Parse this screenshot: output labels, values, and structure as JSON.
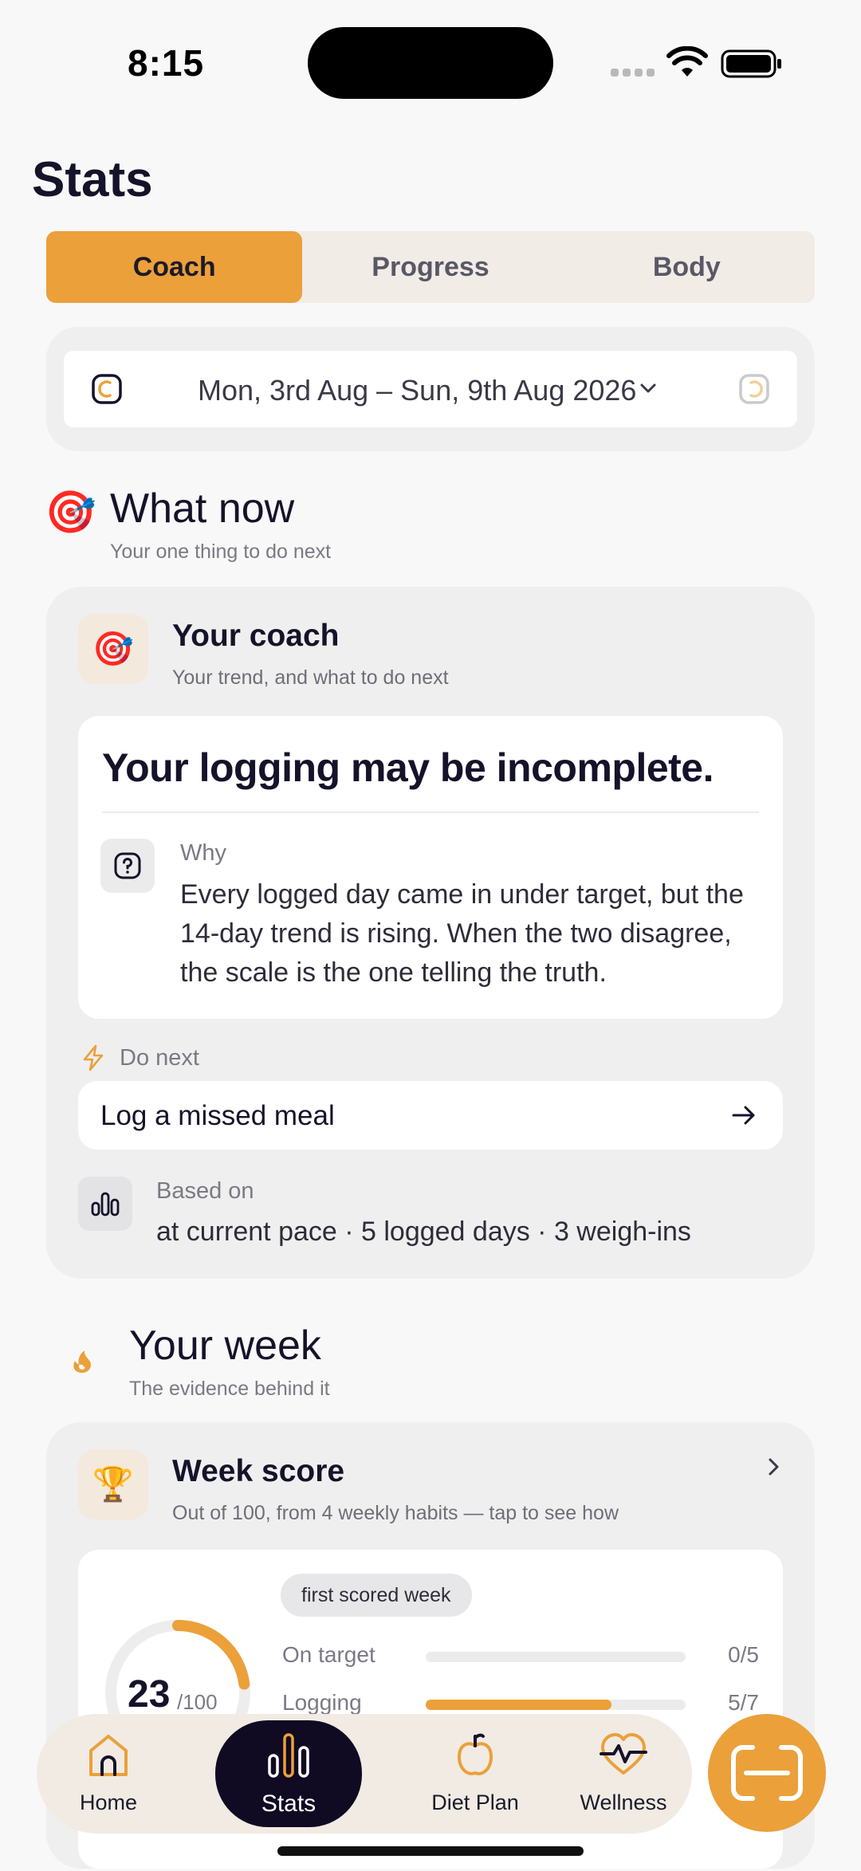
{
  "status_bar": {
    "time": "8:15"
  },
  "page": {
    "title": "Stats"
  },
  "tabs": [
    {
      "label": "Coach",
      "active": true
    },
    {
      "label": "Progress",
      "active": false
    },
    {
      "label": "Body",
      "active": false
    }
  ],
  "date_range": {
    "label": "Mon, 3rd Aug – Sun, 9th Aug 2026"
  },
  "what_now": {
    "emoji": "🎯",
    "title": "What now",
    "subtitle": "Your one thing to do next"
  },
  "coach_card": {
    "icon": "🎯",
    "title": "Your coach",
    "subtitle": "Your trend, and what to do next",
    "headline": "Your logging may be incomplete.",
    "why_label": "Why",
    "why_text": "Every logged day came in under target, but the 14-day trend is rising. When the two disagree, the scale is the one telling the truth.",
    "do_next_label": "Do next",
    "action_label": "Log a missed meal",
    "based_on_label": "Based on",
    "based_on_text": "at current pace · 5 logged days · 3 weigh-ins"
  },
  "your_week": {
    "title": "Your week",
    "subtitle": "The evidence behind it"
  },
  "week_score": {
    "icon": "🏆",
    "title": "Week score",
    "subtitle": "Out of 100, from 4 weekly habits — tap to see how",
    "pill": "first scored week",
    "score": "23",
    "score_max": "/100",
    "score_fraction": 0.23,
    "metrics": [
      {
        "label": "On target",
        "value": "0/5",
        "fraction": 0
      },
      {
        "label": "Logging",
        "value": "5/7",
        "fraction": 0.714
      }
    ]
  },
  "nav": [
    {
      "label": "Home",
      "icon": "home-icon",
      "active": false
    },
    {
      "label": "Stats",
      "icon": "stats-icon",
      "active": true
    },
    {
      "label": "Diet Plan",
      "icon": "apple-icon",
      "active": false
    },
    {
      "label": "Wellness",
      "icon": "heart-pulse-icon",
      "active": false
    }
  ],
  "colors": {
    "accent": "#eba03a",
    "nav_active": "#100a22",
    "text": "#15132a"
  }
}
